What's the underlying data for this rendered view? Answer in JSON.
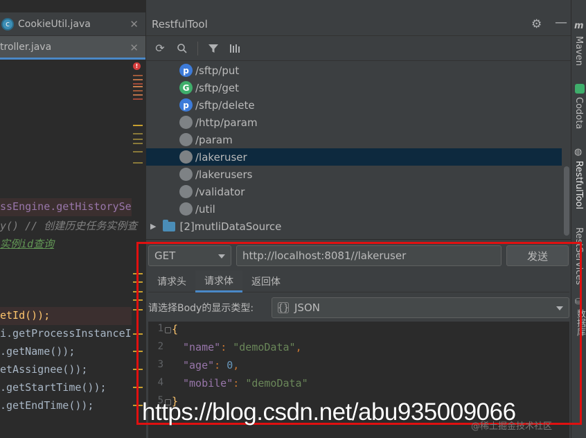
{
  "editor": {
    "tabs": [
      {
        "label": "CookieUtil.java",
        "icon": "java-class-icon"
      },
      {
        "label": "troller.java",
        "icon": ""
      }
    ],
    "code_lines": [
      {
        "text": "ssEngine.getHistorySe",
        "color": "#9876aa"
      },
      {
        "text": "y() // 创建历史任务实例查",
        "color": "#808080"
      },
      {
        "text": "实例id查询",
        "color": "#629755"
      },
      {
        "text": "etId());",
        "color": "#a9b7c6"
      },
      {
        "text": "i.getProcessInstanceI",
        "color": "#a9b7c6"
      },
      {
        "text": ".getName());",
        "color": "#a9b7c6"
      },
      {
        "text": "etAssignee());",
        "color": "#a9b7c6"
      },
      {
        "text": ".getStartTime());",
        "color": "#a9b7c6"
      },
      {
        "text": ".getEndTime());",
        "color": "#a9b7c6"
      }
    ]
  },
  "panel": {
    "title": "RestfulTool",
    "tree": [
      {
        "method": "p",
        "path": "/sftp/put",
        "selected": false
      },
      {
        "method": "G",
        "path": "/sftp/get",
        "selected": false
      },
      {
        "method": "p",
        "path": "/sftp/delete",
        "selected": false
      },
      {
        "method": "",
        "path": "/http/param",
        "selected": false
      },
      {
        "method": "",
        "path": "/param",
        "selected": false
      },
      {
        "method": "",
        "path": "/lakeruser",
        "selected": true
      },
      {
        "method": "",
        "path": "/lakerusers",
        "selected": false
      },
      {
        "method": "",
        "path": "/validator",
        "selected": false
      },
      {
        "method": "",
        "path": "/util",
        "selected": false
      }
    ],
    "folder": "[2]mutliDataSource",
    "request": {
      "method": "GET",
      "url": "http://localhost:8081//lakeruser",
      "send_label": "发送",
      "tabs": [
        "请求头",
        "请求体",
        "返回体"
      ],
      "active_tab": "请求体",
      "body_type_label": "请选择Body的显示类型:",
      "body_type": "JSON",
      "json_lines": [
        {
          "no": "1",
          "text": "{"
        },
        {
          "no": "2",
          "key": "\"name\"",
          "value": "\"demoData\"",
          "vtype": "s",
          "comma": ","
        },
        {
          "no": "3",
          "key": "\"age\"",
          "value": "0",
          "vtype": "n",
          "comma": ","
        },
        {
          "no": "4",
          "key": "\"mobile\"",
          "value": "\"demoData\"",
          "vtype": "s",
          "comma": ""
        },
        {
          "no": "5",
          "text": "}"
        }
      ]
    }
  },
  "right_strip": [
    "Maven",
    "Codota",
    "RestfulTool",
    "RestServices",
    "数据库"
  ],
  "watermark": "https://blog.csdn.net/abu935009066",
  "credit": "@稀土掘金技术社区"
}
